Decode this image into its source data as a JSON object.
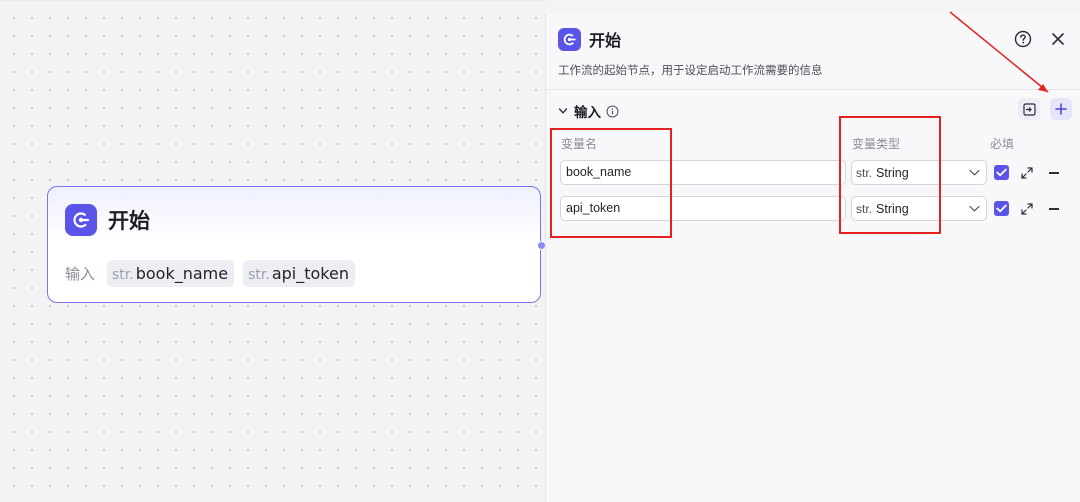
{
  "canvas": {
    "node": {
      "title": "开始",
      "inputs_label": "输入",
      "inputs": [
        {
          "type": "str.",
          "name": "book_name"
        },
        {
          "type": "str.",
          "name": "api_token"
        }
      ]
    }
  },
  "panel": {
    "title": "开始",
    "description": "工作流的起始节点，用于设定启动工作流需要的信息",
    "section_label": "输入",
    "columns": {
      "name": "变量名",
      "type": "变量类型",
      "required": "必填"
    },
    "rows": [
      {
        "name": "book_name",
        "type_prefix": "str.",
        "type": "String",
        "required": true
      },
      {
        "name": "api_token",
        "type_prefix": "str.",
        "type": "String",
        "required": true
      }
    ]
  },
  "colors": {
    "accent": "#5a55e8",
    "node_border": "#7b74f0",
    "annotation": "#e3221f"
  },
  "icons": [
    "start-node-icon",
    "help-icon",
    "close-icon",
    "collapse-chevron-icon",
    "info-icon",
    "import-icon",
    "plus-icon",
    "chevron-down-icon",
    "checkmark-icon",
    "expand-icon",
    "minus-icon"
  ]
}
